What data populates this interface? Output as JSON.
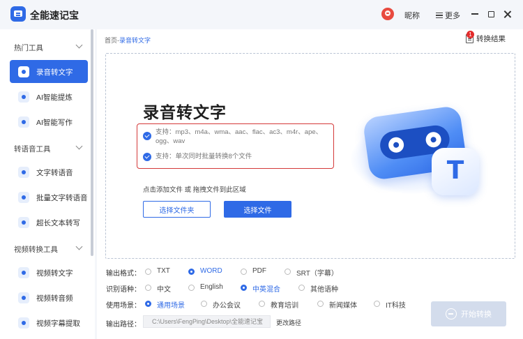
{
  "app": {
    "title": "全能速记宝",
    "nickname": "昵称",
    "more_label": "更多"
  },
  "sidebar": {
    "sections": [
      {
        "title": "热门工具",
        "items": [
          {
            "label": "录音转文字",
            "active": true
          },
          {
            "label": "AI智能提炼"
          },
          {
            "label": "AI智能写作"
          }
        ]
      },
      {
        "title": "转语音工具",
        "items": [
          {
            "label": "文字转语音"
          },
          {
            "label": "批量文字转语音"
          },
          {
            "label": "超长文本转写"
          }
        ]
      },
      {
        "title": "视频转换工具",
        "items": [
          {
            "label": "视频转文字"
          },
          {
            "label": "视频转音频"
          },
          {
            "label": "视频字幕提取"
          }
        ]
      }
    ]
  },
  "breadcrumb": {
    "home": "首页",
    "sep": "-",
    "current": "录音转文字"
  },
  "result": {
    "label": "转换结果",
    "badge": "1"
  },
  "hero": {
    "title": "录音转文字",
    "support_formats": "支持：mp3、m4a、wma、aac、flac、ac3、m4r、ape、ogg、wav",
    "support_batch": "支持：单次同时批量转换8个文件",
    "add_hint": "点击添加文件 或 拖拽文件到此区域",
    "btn_folder": "选择文件夹",
    "btn_file": "选择文件"
  },
  "settings": {
    "format": {
      "label": "输出格式：",
      "options": [
        "TXT",
        "WORD",
        "PDF",
        "SRT（字幕）"
      ],
      "selected": "WORD"
    },
    "language": {
      "label": "识别语种：",
      "options": [
        "中文",
        "English",
        "中英混合",
        "其他语种"
      ],
      "selected": "中英混合"
    },
    "scene": {
      "label": "使用场景：",
      "options": [
        "通用场景",
        "办公会议",
        "教育培训",
        "新闻媒体",
        "IT科技"
      ],
      "selected": "通用场景"
    },
    "path": {
      "label": "输出路径：",
      "value": "C:\\Users\\FengPing\\Desktop\\全能速记宝",
      "change": "更改路径"
    }
  },
  "start_button": "开始转换",
  "colors": {
    "accent": "#2f6ae6",
    "highlight_border": "#d43838",
    "disabled": "#d3dcec"
  }
}
